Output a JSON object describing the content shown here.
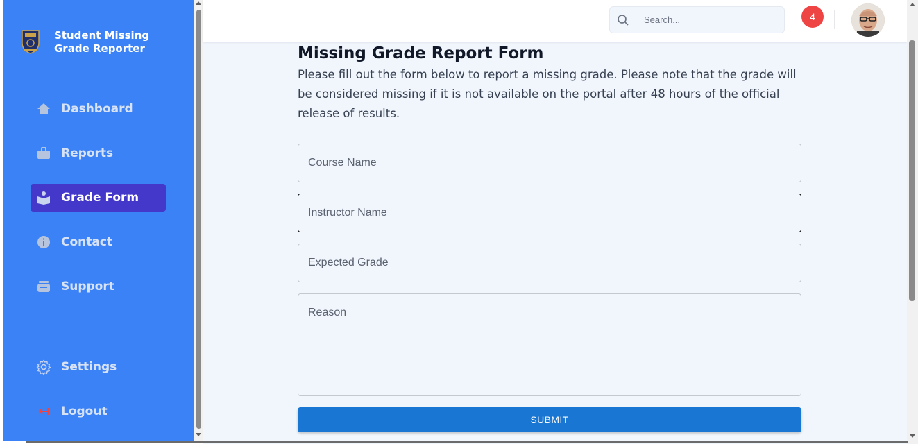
{
  "brand": {
    "title": "Student Missing Grade Reporter",
    "logo": "university-crest-icon"
  },
  "sidebar": {
    "items": [
      {
        "label": "Dashboard",
        "icon": "home-icon",
        "active": false
      },
      {
        "label": "Reports",
        "icon": "briefcase-icon",
        "active": false
      },
      {
        "label": "Grade Form",
        "icon": "book-reader-icon",
        "active": true
      },
      {
        "label": "Contact",
        "icon": "info-icon",
        "active": false
      },
      {
        "label": "Support",
        "icon": "inbox-icon",
        "active": false
      }
    ],
    "bottom_items": [
      {
        "label": "Settings",
        "icon": "gear-icon"
      },
      {
        "label": "Logout",
        "icon": "logout-icon"
      }
    ]
  },
  "topbar": {
    "search_placeholder": "Search...",
    "notifications_count": "4"
  },
  "form": {
    "title": "Missing Grade Report Form",
    "intro": "Please fill out the form below to report a missing grade. Please note that the grade will be considered missing if it is not available on the portal after 48 hours of the official release of results.",
    "fields": {
      "course_name": "Course Name",
      "instructor_name": "Instructor Name",
      "expected_grade": "Expected Grade",
      "reason": "Reason"
    },
    "submit_label": "SUBMIT"
  },
  "colors": {
    "sidebar_bg": "#3b82f6",
    "active_item_bg": "#4338ca",
    "submit_bg": "#1976d2",
    "badge_bg": "#ef4444",
    "main_bg": "#f1f6fd"
  }
}
